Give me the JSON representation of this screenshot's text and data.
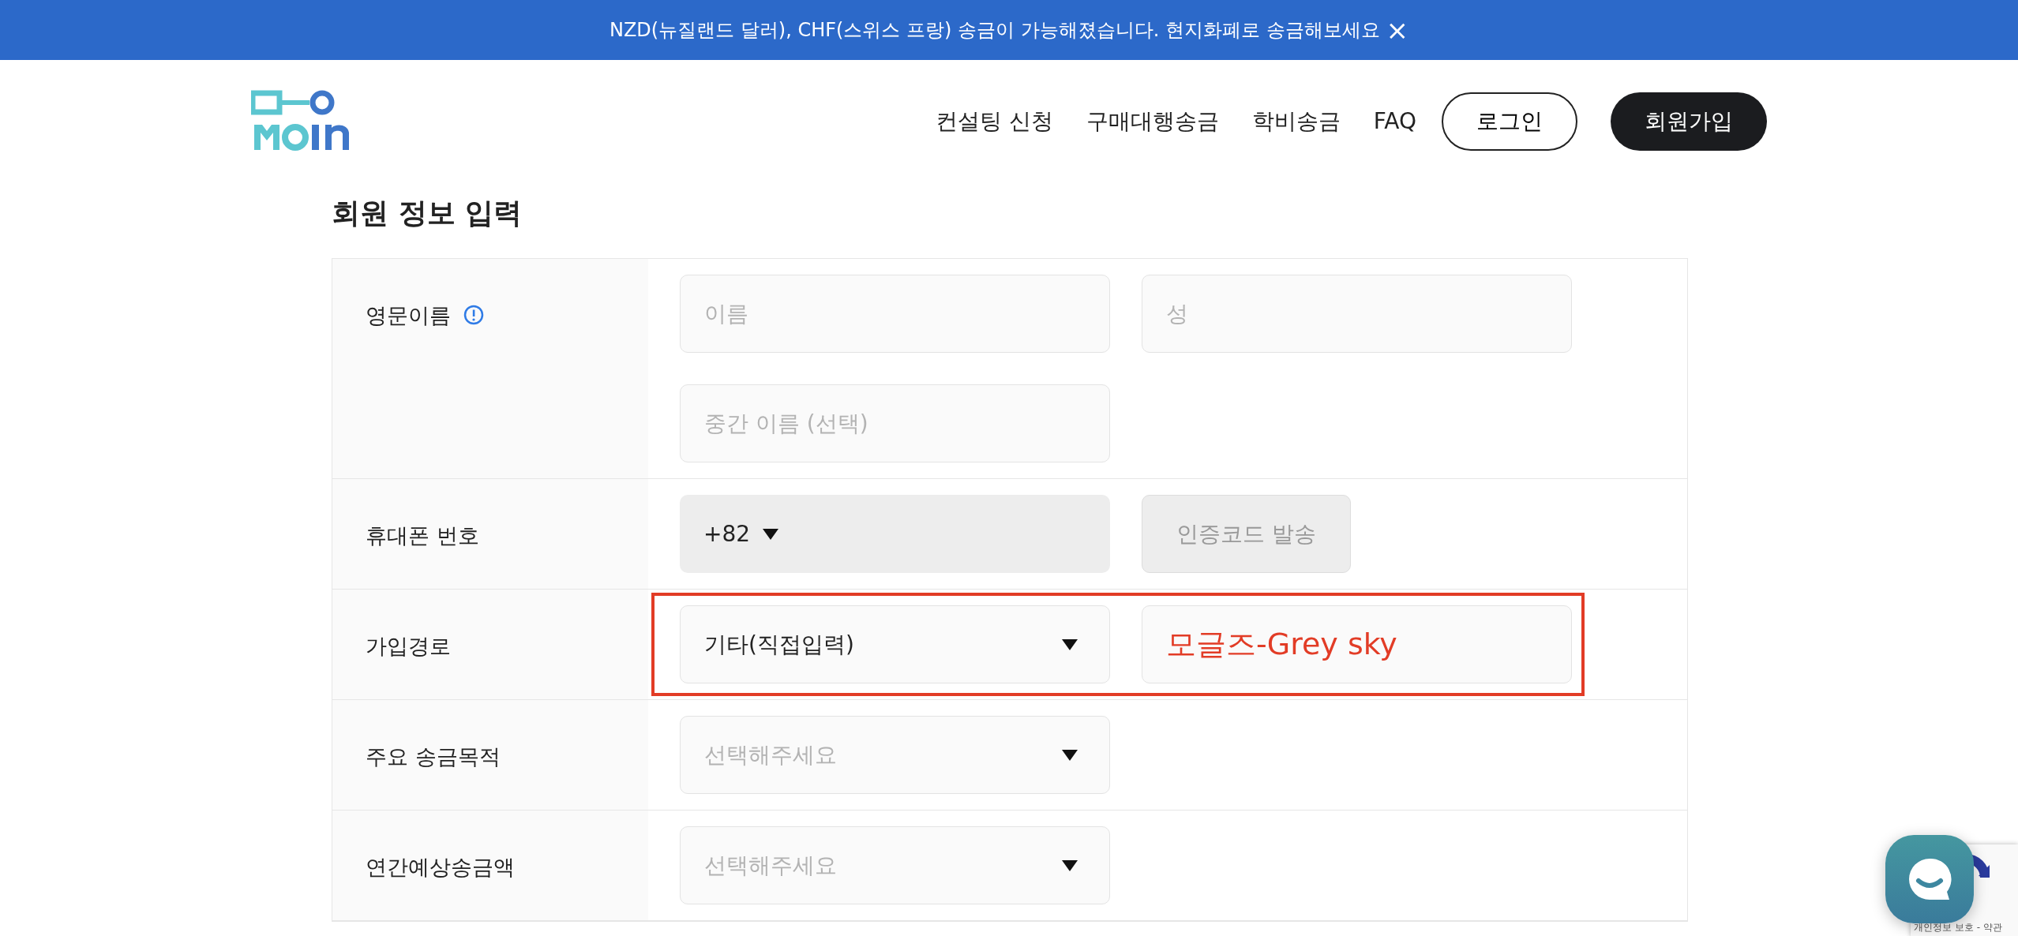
{
  "banner": {
    "text": "NZD(뉴질랜드 달러), CHF(스위스 프랑) 송금이 가능해졌습니다. 현지화폐로 송금해보세요",
    "close": "×"
  },
  "nav": {
    "links": [
      "컨설팅 신청",
      "구매대행송금",
      "학비송금",
      "FAQ"
    ],
    "login": "로그인",
    "signup": "회원가입"
  },
  "title": "회원 정보 입력",
  "rows": [
    {
      "label": "영문이름",
      "info": true,
      "fields": [
        {
          "kind": "input",
          "placeholder": "이름"
        },
        {
          "kind": "input",
          "placeholder": "성"
        },
        {
          "kind": "input",
          "placeholder": "중간 이름 (선택)"
        }
      ]
    },
    {
      "label": "휴대폰 번호",
      "info": false,
      "fields": [
        {
          "kind": "code",
          "value": "+82"
        },
        {
          "kind": "button",
          "label": "인증코드 발송",
          "disabled": true
        }
      ]
    },
    {
      "label": "가입경로",
      "info": false,
      "highlighted": true,
      "fields": [
        {
          "kind": "select",
          "value": "기타(직접입력)"
        },
        {
          "kind": "input",
          "value": "모글즈-Grey sky",
          "annotated": true
        }
      ]
    },
    {
      "label": "주요 송금목적",
      "info": false,
      "fields": [
        {
          "kind": "select",
          "placeholder": "선택해주세요"
        }
      ]
    },
    {
      "label": "연간예상송금액",
      "info": false,
      "fields": [
        {
          "kind": "select",
          "placeholder": "선택해주세요"
        }
      ]
    }
  ],
  "recaptcha": {
    "text": "개인정보 보호 - 약관"
  }
}
